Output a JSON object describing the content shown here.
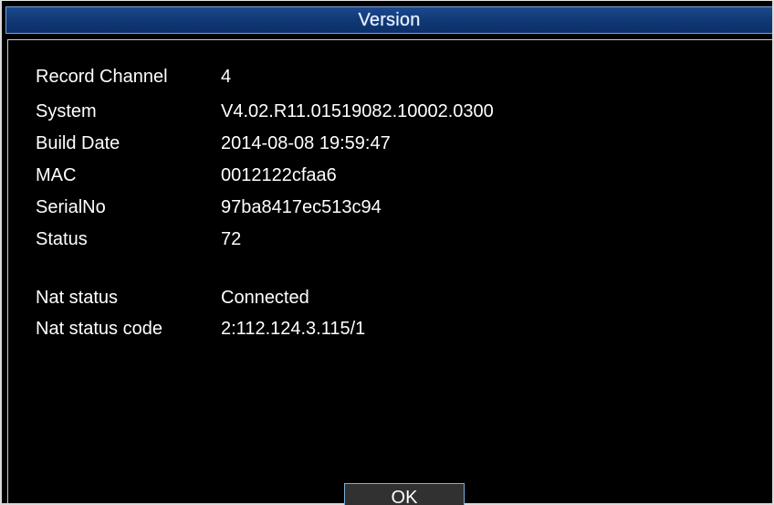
{
  "window": {
    "title": "Version"
  },
  "info": {
    "rows": [
      {
        "label": "Record Channel",
        "value": "4"
      },
      {
        "label": "System",
        "value": "V4.02.R11.01519082.10002.0300"
      },
      {
        "label": "Build Date",
        "value": "2014-08-08 19:59:47"
      },
      {
        "label": "MAC",
        "value": "0012122cfaa6"
      },
      {
        "label": "SerialNo",
        "value": "97ba8417ec513c94"
      },
      {
        "label": "Status",
        "value": "72"
      },
      {
        "label": "Nat status",
        "value": "Connected"
      },
      {
        "label": "Nat status code",
        "value": "2:112.124.3.115/1"
      }
    ]
  },
  "buttons": {
    "ok": "OK"
  }
}
